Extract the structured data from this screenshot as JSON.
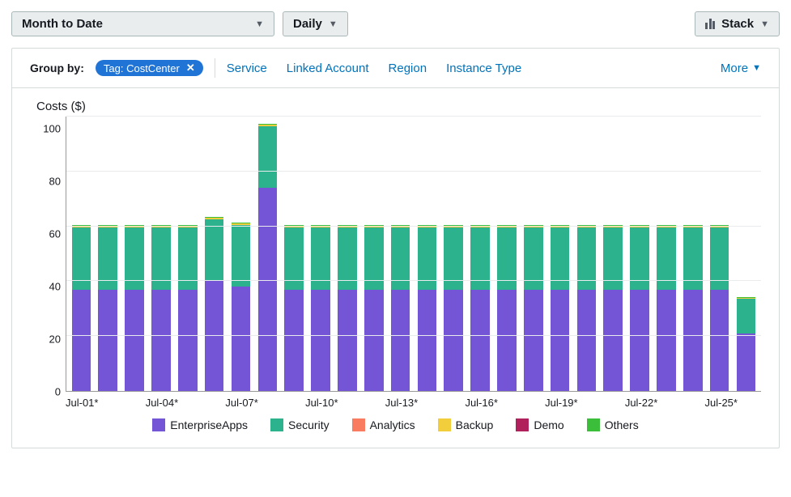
{
  "toolbar": {
    "period_label": "Month to Date",
    "granularity_label": "Daily",
    "chart_mode_label": "Stack"
  },
  "groupby": {
    "label": "Group by:",
    "active_tag": "Tag: CostCenter",
    "options": [
      "Service",
      "Linked Account",
      "Region",
      "Instance Type"
    ],
    "more_label": "More"
  },
  "chart_data": {
    "type": "bar",
    "title": "Costs ($)",
    "ylabel": "Costs ($)",
    "ylim": [
      0,
      100
    ],
    "y_ticks": [
      100,
      80,
      60,
      40,
      20,
      0
    ],
    "categories": [
      "Jul-01*",
      "Jul-02*",
      "Jul-03*",
      "Jul-04*",
      "Jul-05*",
      "Jul-06*",
      "Jul-07*",
      "Jul-08*",
      "Jul-09*",
      "Jul-10*",
      "Jul-11*",
      "Jul-12*",
      "Jul-13*",
      "Jul-14*",
      "Jul-15*",
      "Jul-16*",
      "Jul-17*",
      "Jul-18*",
      "Jul-19*",
      "Jul-20*",
      "Jul-21*",
      "Jul-22*",
      "Jul-23*",
      "Jul-24*",
      "Jul-25*",
      "Jul-26*"
    ],
    "x_tick_labels": [
      "Jul-01*",
      "Jul-04*",
      "Jul-07*",
      "Jul-10*",
      "Jul-13*",
      "Jul-16*",
      "Jul-19*",
      "Jul-22*",
      "Jul-25*"
    ],
    "x_tick_indices": [
      0,
      3,
      6,
      9,
      12,
      15,
      18,
      21,
      24
    ],
    "series": [
      {
        "name": "EnterpriseApps",
        "color": "#7455d6",
        "values": [
          37,
          37,
          37,
          37,
          37,
          40,
          38,
          74,
          37,
          37,
          37,
          37,
          37,
          37,
          37,
          37,
          37,
          37,
          37,
          37,
          37,
          37,
          37,
          37,
          37,
          21
        ]
      },
      {
        "name": "Security",
        "color": "#2db28e",
        "values": [
          22.5,
          22.5,
          22.5,
          22.5,
          22.5,
          22.5,
          22.5,
          22.5,
          22.5,
          22.5,
          22.5,
          22.5,
          22.5,
          22.5,
          22.5,
          22.5,
          22.5,
          22.5,
          22.5,
          22.5,
          22.5,
          22.5,
          22.5,
          22.5,
          22.5,
          12.5
        ]
      },
      {
        "name": "Analytics",
        "color": "#f97b60",
        "values": [
          0,
          0,
          0,
          0,
          0,
          0,
          0,
          0,
          0,
          0,
          0,
          0,
          0,
          0,
          0,
          0,
          0,
          0,
          0,
          0,
          0,
          0,
          0,
          0,
          0,
          0
        ]
      },
      {
        "name": "Backup",
        "color": "#f2cd3c",
        "values": [
          0.5,
          0.5,
          0.5,
          0.5,
          0.5,
          0.5,
          0.5,
          0.5,
          0.5,
          0.5,
          0.5,
          0.5,
          0.5,
          0.5,
          0.5,
          0.5,
          0.5,
          0.5,
          0.5,
          0.5,
          0.5,
          0.5,
          0.5,
          0.5,
          0.5,
          0.5
        ]
      },
      {
        "name": "Demo",
        "color": "#b0215c",
        "values": [
          0,
          0,
          0,
          0,
          0,
          0,
          0,
          0,
          0,
          0,
          0,
          0,
          0,
          0,
          0,
          0,
          0,
          0,
          0,
          0,
          0,
          0,
          0,
          0,
          0,
          0
        ]
      },
      {
        "name": "Others",
        "color": "#3bbf3b",
        "values": [
          0.5,
          0.5,
          0.5,
          0.5,
          0.5,
          0.5,
          0.5,
          0.5,
          0.5,
          0.5,
          0.5,
          0.5,
          0.5,
          0.5,
          0.5,
          0.5,
          0.5,
          0.5,
          0.5,
          0.5,
          0.5,
          0.5,
          0.5,
          0.5,
          0.5,
          0.3
        ]
      }
    ]
  }
}
